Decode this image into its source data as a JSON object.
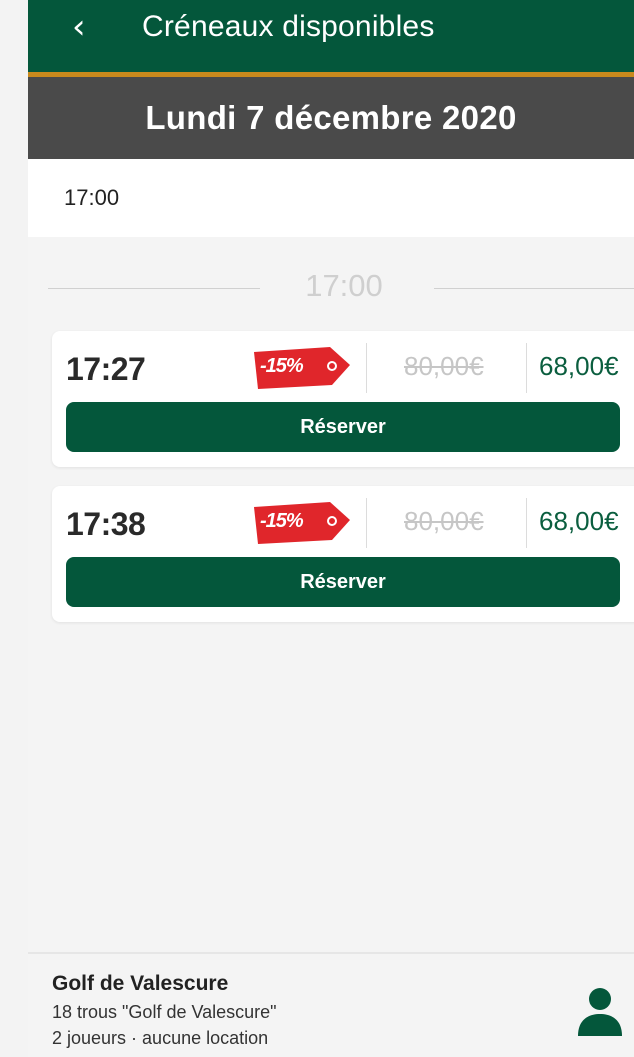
{
  "header": {
    "back_icon": "chevron-left-icon",
    "title": "Créneaux disponibles"
  },
  "date_bar": {
    "title": "Lundi 7 décembre 2020"
  },
  "time_selector": {
    "value": "17:00"
  },
  "group_divider": {
    "label": "17:00"
  },
  "slots": [
    {
      "time": "17:27",
      "discount": "-15%",
      "old_price": "80,00€",
      "new_price": "68,00€",
      "button_label": "Réserver"
    },
    {
      "time": "17:38",
      "discount": "-15%",
      "old_price": "80,00€",
      "new_price": "68,00€",
      "button_label": "Réserver"
    }
  ],
  "footer": {
    "club_name": "Golf de Valescure",
    "course": "18 trous \"Golf de Valescure\"",
    "details": "2 joueurs · aucune location",
    "user_icon": "user-icon"
  },
  "colors": {
    "primary_green": "#04573b",
    "accent_orange": "#c98a1d",
    "date_bar": "#4a4a4a",
    "discount_red": "#e0262b",
    "price_green": "#0b5e3f"
  }
}
